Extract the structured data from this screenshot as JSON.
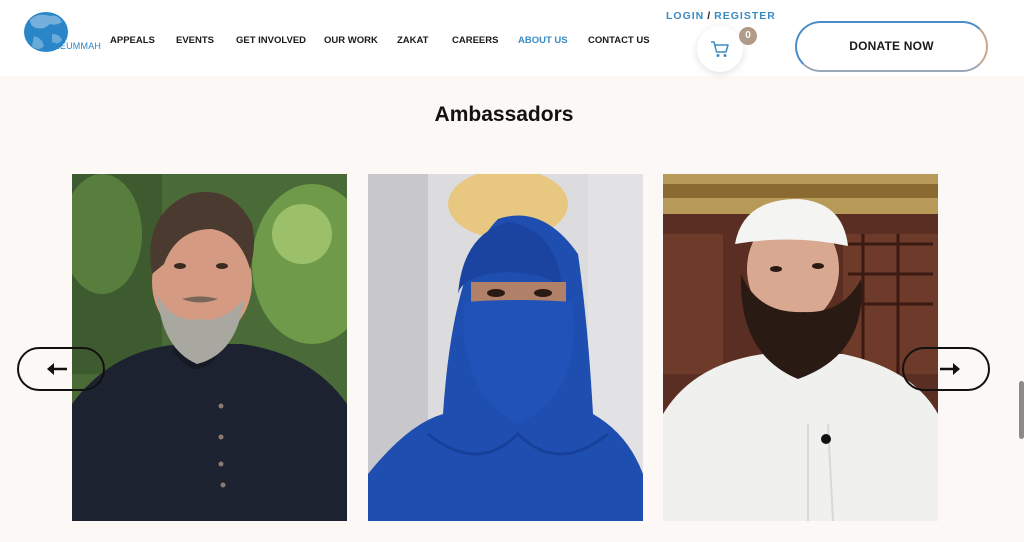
{
  "logo": {
    "text": "ONEUMMAH",
    "icon": "globe-logo-icon"
  },
  "nav": [
    {
      "label": "APPEALS",
      "active": false
    },
    {
      "label": "EVENTS",
      "active": false
    },
    {
      "label": "GET INVOLVED",
      "active": false
    },
    {
      "label": "OUR WORK",
      "active": false
    },
    {
      "label": "ZAKAT",
      "active": false
    },
    {
      "label": "CAREERS",
      "active": false
    },
    {
      "label": "ABOUT US",
      "active": true
    },
    {
      "label": "CONTACT US",
      "active": false
    }
  ],
  "auth": {
    "login": "LOGIN",
    "separator": "/",
    "register": "REGISTER"
  },
  "cart": {
    "count": "0",
    "icon": "shopping-cart-icon"
  },
  "donate_label": "DONATE NOW",
  "section_title": "Ambassadors",
  "carousel": {
    "prev_icon": "arrow-left-icon",
    "next_icon": "arrow-right-icon",
    "cards": [
      {
        "photo": "ambassador-photo-1"
      },
      {
        "photo": "ambassador-photo-2"
      },
      {
        "photo": "ambassador-photo-3"
      }
    ]
  },
  "colors": {
    "accent": "#3a8bc4",
    "background": "#fcf8f5",
    "badge": "#b09a88"
  }
}
